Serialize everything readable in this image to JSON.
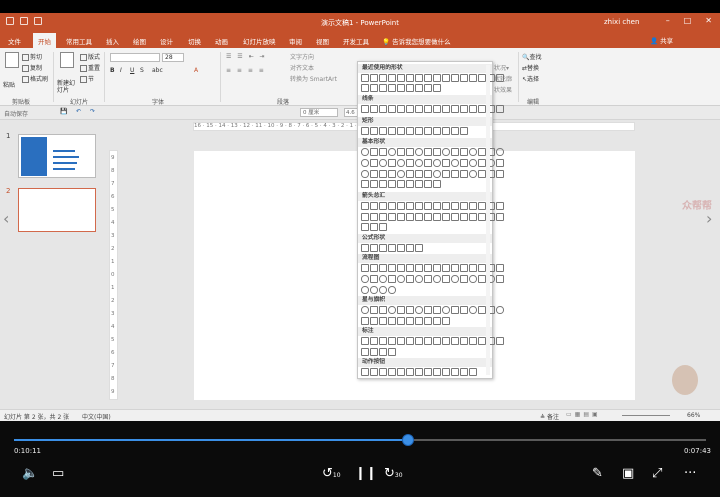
{
  "window": {
    "title": "演示文稿1 - PowerPoint",
    "user": "zhixi chen",
    "controls": [
      "–",
      "□",
      "✕"
    ]
  },
  "tabs": [
    {
      "label": "文件",
      "active": false
    },
    {
      "label": "开始",
      "active": true
    },
    {
      "label": "常用工具",
      "active": false
    },
    {
      "label": "插入",
      "active": false
    },
    {
      "label": "绘图",
      "active": false
    },
    {
      "label": "设计",
      "active": false
    },
    {
      "label": "切换",
      "active": false
    },
    {
      "label": "动画",
      "active": false
    },
    {
      "label": "幻灯片放映",
      "active": false
    },
    {
      "label": "审阅",
      "active": false
    },
    {
      "label": "视图",
      "active": false
    },
    {
      "label": "开发工具",
      "active": false
    }
  ],
  "tell_me": "告诉我您想要做什么",
  "share": "共享",
  "ribbon": {
    "clipboard": {
      "paste": "粘贴",
      "cut": "剪切",
      "copy": "复制",
      "format_painter": "格式刷",
      "group": "剪贴板"
    },
    "slides": {
      "new_slide": "新建幻灯片",
      "layout": "版式",
      "reset": "重置",
      "section": "节",
      "group": "幻灯片"
    },
    "font": {
      "size": "28",
      "group": "字体"
    },
    "paragraph": {
      "text_direction": "文字方向",
      "align_text": "对齐文本",
      "convert_smartart": "转换为 SmartArt",
      "group": "段落"
    },
    "editing": {
      "find": "查找",
      "replace": "替换",
      "select": "选择",
      "group": "编辑"
    },
    "arrange_frag": [
      "状况▾",
      "状轮廓",
      "状效果"
    ]
  },
  "qat2": {
    "autosave": "自动保存",
    "width": "0 厘米",
    "height": "4.6"
  },
  "thumbnails": [
    {
      "number": "1",
      "selected": false
    },
    {
      "number": "2",
      "selected": true
    }
  ],
  "ruler_text": "16 · 15 · 14 · 13 · 12 · 11 · 10 · 9 · 8 · 7 · 6 · 5 · 4 · 3 · 2 · 1 · 0 · 1 · 2 · 3 · 4 · 5 · 6 · 7 · 8 · 9",
  "vruler": [
    "9",
    "8",
    "7",
    "6",
    "5",
    "4",
    "3",
    "2",
    "1",
    "0",
    "1",
    "2",
    "3",
    "4",
    "5",
    "6",
    "7",
    "8",
    "9"
  ],
  "shapes_menu": {
    "sections": [
      "最近使用的形状",
      "线条",
      "矩形",
      "基本形状",
      "箭头总汇",
      "公式形状",
      "流程图",
      "星与旗帜",
      "标注",
      "动作按钮"
    ]
  },
  "status": {
    "slide_info": "幻灯片 第 2 张，共 2 张",
    "language": "中文(中国)",
    "notes": "备注",
    "zoom": "66%"
  },
  "watermark": "众帮帮",
  "player": {
    "current_time": "0:10:11",
    "total_time": "0:07:43",
    "progress": 0.57,
    "skip_back": "10",
    "skip_forward": "30",
    "accent_color": "#3b8fe6"
  }
}
